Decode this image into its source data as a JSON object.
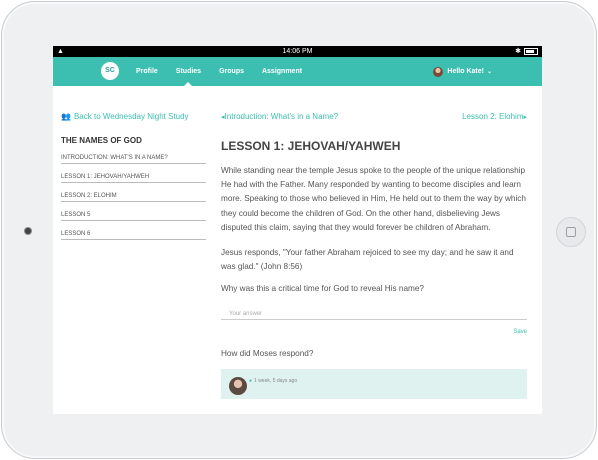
{
  "status_bar": {
    "time": "14:06 PM"
  },
  "nav": {
    "logo": "SC",
    "items": [
      {
        "label": "Profile"
      },
      {
        "label": "Studies"
      },
      {
        "label": "Groups"
      },
      {
        "label": "Assignment"
      }
    ],
    "user_greeting": "Hello Kate!"
  },
  "sidebar": {
    "back_link": "Back to Wednesday Night Study",
    "series_title": "THE NAMES OF GOD",
    "lessons": [
      {
        "label": "INTRODUCTION: WHAT'S IN A NAME?"
      },
      {
        "label": "LESSON 1: JEHOVAH/YAHWEH"
      },
      {
        "label": "LESSON 2: ELOHIM"
      },
      {
        "label": "LESSON 5"
      },
      {
        "label": "LESSON 6"
      }
    ]
  },
  "main": {
    "prev_link": "Introduction: What's in a Name?",
    "next_link": "Lesson 2: Elohim",
    "title": "LESSON 1: JEHOVAH/YAHWEH",
    "paragraph1": "While standing near the temple Jesus spoke to the people of the unique relationship He had with the Father. Many responded by wanting to become disciples and learn more. Speaking to those who believed in Him, He held out to them the way by which they could become the children of God. On the other hand, disbelieving Jews disputed this claim, saying that they would forever be children of Abraham.",
    "paragraph2": "Jesus responds, \"Your father Abraham rejoiced to see my day; and he saw it and was glad.\" (John 8:56)",
    "question1": "Why was this a critical time for God to reveal His name?",
    "answer_placeholder": "Your answer",
    "save_label": "Save",
    "question2": "How did Moses respond?",
    "response_meta": "1 week, 5 days ago"
  }
}
